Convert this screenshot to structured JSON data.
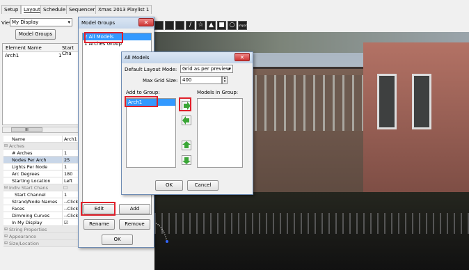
{
  "tabs": [
    "Setup",
    "Layout",
    "Schedule",
    "Sequencer",
    "Xmas 2013 Playlist 1"
  ],
  "view_label": "View:",
  "view_value": "My Display",
  "model_groups_button": "Model Groups",
  "element_table": {
    "col1": "Element Name",
    "col2": "Start Cha",
    "rows": [
      {
        "name": "Arch1",
        "start": "1"
      }
    ]
  },
  "scroll_label": "III",
  "props": {
    "name_key": "Name",
    "name_val": "Arch1",
    "groups": {
      "arches": "Arches",
      "indiv": "Indiv Start Chans",
      "string_props": "String Properties",
      "appearance": "Appearance",
      "size": "Size/Location"
    },
    "rows": [
      {
        "k": "# Arches",
        "v": "1"
      },
      {
        "k": "Nodes Per Arch",
        "v": "25"
      },
      {
        "k": "Lights Per Node",
        "v": "1"
      },
      {
        "k": "Arc Degrees",
        "v": "180"
      },
      {
        "k": "Starting Location",
        "v": "Left"
      }
    ],
    "rows2": [
      {
        "k": "Start Channel",
        "v": "1"
      },
      {
        "k": "Strand/Node Names",
        "v": "--Click T"
      },
      {
        "k": "Faces",
        "v": "--Click T"
      },
      {
        "k": "Dimming Curves",
        "v": "--Click T"
      },
      {
        "k": "In My Display",
        "v": "☑"
      }
    ]
  },
  "model_groups_dialog": {
    "title": "Model Groups",
    "items": [
      "2 All Models",
      "1 Arches Group"
    ],
    "edit": "Edit",
    "add": "Add",
    "rename": "Rename",
    "remove": "Remove",
    "ok": "OK"
  },
  "all_models_dialog": {
    "title": "All Models",
    "layout_mode_label": "Default Layout Mode:",
    "layout_mode_value": "Grid as per preview",
    "grid_size_label": "Max Grid Size:",
    "grid_size_value": "400",
    "add_to_group": "Add to Group:",
    "models_in_group": "Models in Group:",
    "add_list": [
      "Arch1"
    ],
    "ok": "OK",
    "cancel": "Cancel"
  },
  "toolbar_import": "import",
  "colors": {
    "highlight": "#e0202a",
    "selection": "#3399ff"
  }
}
